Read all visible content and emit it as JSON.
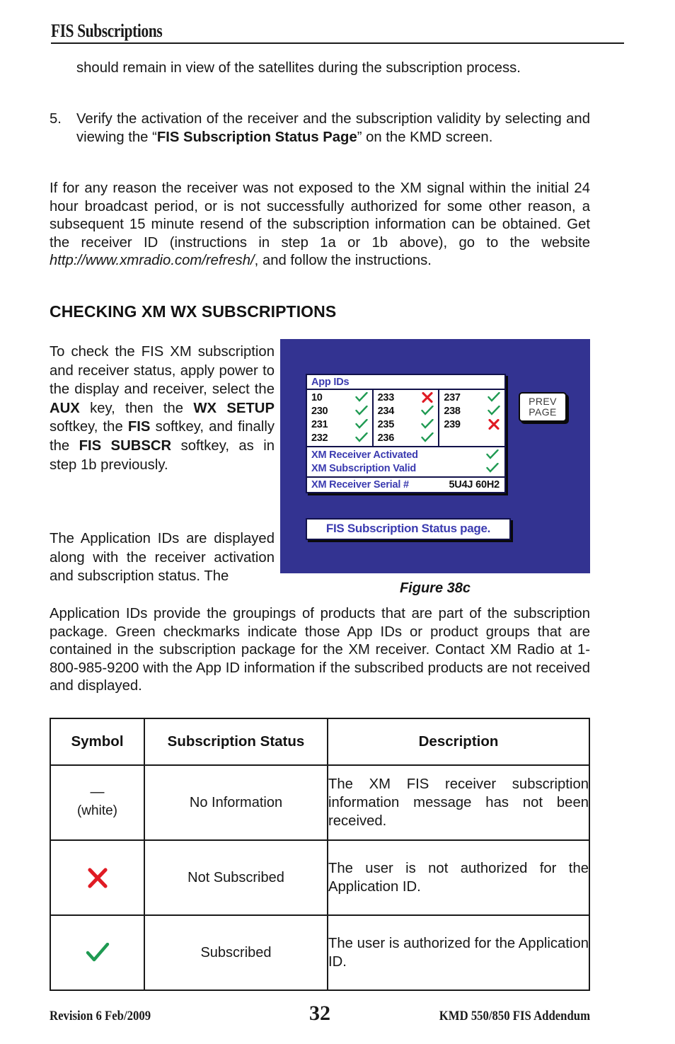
{
  "running_head": {
    "title": "FIS Subscriptions"
  },
  "body": {
    "para_continuation": "should remain in view of the satellites during the subscription process.",
    "step5": {
      "number": "5.",
      "text_before": "Verify the activation of the receiver and the subscription validity by selecting and viewing the “",
      "bold_phrase": "FIS Subscription Status Page",
      "text_after": "” on the KMD screen."
    },
    "para_resend": {
      "text_before": "If for any reason the receiver was not exposed to the XM signal within the initial 24 hour broadcast period, or is not successfully authorized for some other reason, a subsequent 15 minute resend of the subscription information can be obtained. Get the receiver ID (instructions in step 1a or 1b above), go to the website ",
      "italic_url": "http://www.xmradio.com/refresh/",
      "text_after": ", and follow the instructions."
    },
    "section_heading": "CHECKING XM WX SUBSCRIPTIONS",
    "narrow_para1": {
      "s1": "To check the FIS XM subscription and receiver status, apply power to the display and receiver, select the ",
      "b1": "AUX",
      "s2": " key, then the ",
      "b2": "WX SETUP",
      "s3": " softkey, the ",
      "b3": "FIS",
      "s4": " softkey, and finally the ",
      "b4": "FIS SUBSCR",
      "s5": " softkey, as in step 1b previously."
    },
    "narrow_para2_head": "The Application IDs are displayed along with the receiver activation and subscription status. The",
    "wrap_para_rest": "Application IDs provide the groupings of products that are part of the subscription package. Green checkmarks indicate those App IDs or product groups that are contained in the subscription package for the XM receiver. Contact XM Radio at 1-800-985-9200 with the App ID information if the subscribed products are not received and displayed."
  },
  "figure": {
    "label": "Figure 38c",
    "screen_bg_color": "#333391",
    "panel": {
      "title": "App IDs",
      "app_id_columns": [
        [
          {
            "id": "10",
            "mark": "check"
          },
          {
            "id": "230",
            "mark": "check"
          },
          {
            "id": "231",
            "mark": "check"
          },
          {
            "id": "232",
            "mark": "check"
          }
        ],
        [
          {
            "id": "233",
            "mark": "cross"
          },
          {
            "id": "234",
            "mark": "check"
          },
          {
            "id": "235",
            "mark": "check"
          },
          {
            "id": "236",
            "mark": "check"
          }
        ],
        [
          {
            "id": "237",
            "mark": "check"
          },
          {
            "id": "238",
            "mark": "check"
          },
          {
            "id": "239",
            "mark": "cross"
          }
        ]
      ],
      "status_rows": [
        {
          "label": "XM Receiver Activated",
          "mark": "check"
        },
        {
          "label": "XM Subscription Valid",
          "mark": "check"
        }
      ],
      "serial": {
        "label": "XM Receiver Serial #",
        "value": "5U4J 60H2"
      }
    },
    "prev_page_button": {
      "line1": "PREV",
      "line2": "PAGE"
    },
    "caption_box": "FIS Subscription Status page."
  },
  "symbol_table": {
    "headers": [
      "Symbol",
      "Subscription Status",
      "Description"
    ],
    "rows": [
      {
        "symbol_glyph": "dash",
        "symbol_dash": "—",
        "symbol_note": "(white)",
        "status": "No Information",
        "description": "The XM FIS receiver subscription information message has not been received."
      },
      {
        "symbol_glyph": "cross",
        "status": "Not Subscribed",
        "description": "The user is not authorized for the Application ID."
      },
      {
        "symbol_glyph": "check",
        "status": "Subscribed",
        "description": "The user is authorized for the Application ID."
      }
    ]
  },
  "colors": {
    "check_green": "#1f9a52",
    "cross_red": "#e01b24",
    "screen_blue": "#333391",
    "panel_label_blue": "#3b3bb0"
  },
  "footer": {
    "left": "Revision 6  Feb/2009",
    "page": "32",
    "right": "KMD 550/850 FIS Addendum"
  }
}
